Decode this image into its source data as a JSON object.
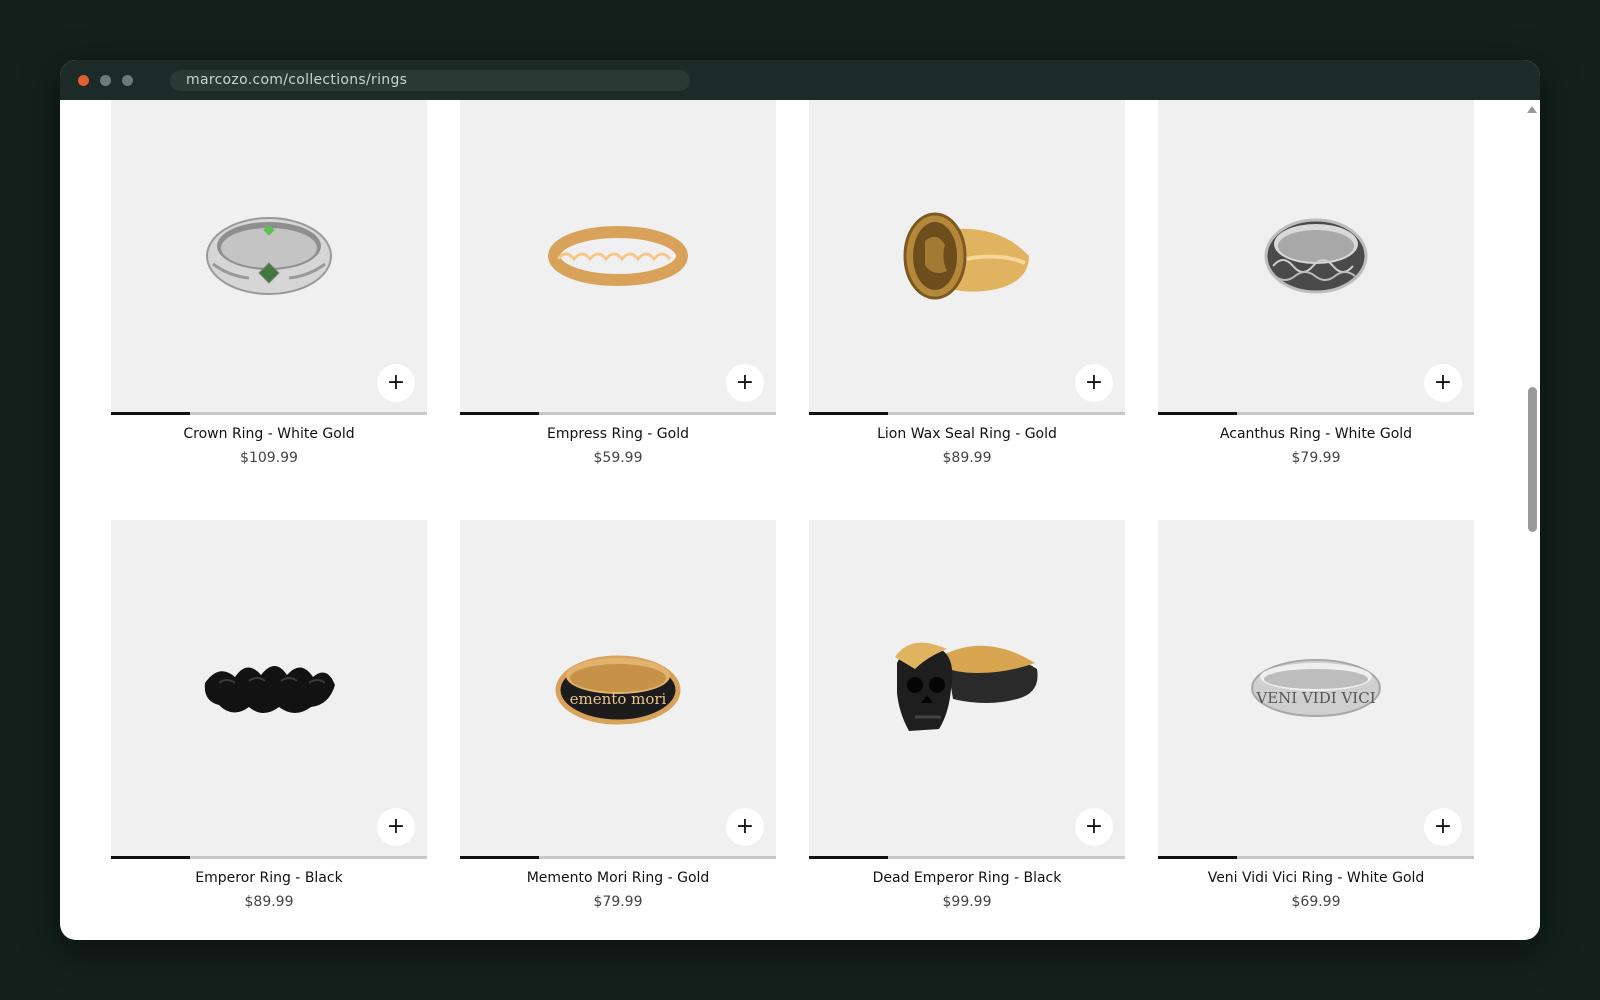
{
  "browser": {
    "url": "marcozo.com/collections/rings"
  },
  "products": [
    {
      "name": "Crown Ring - White Gold",
      "price": "$109.99",
      "add_icon": "plus-icon",
      "add_label": "+",
      "image_progress": 0.25
    },
    {
      "name": "Empress Ring - Gold",
      "price": "$59.99",
      "add_icon": "plus-icon",
      "add_label": "+",
      "image_progress": 0.25
    },
    {
      "name": "Lion Wax Seal Ring - Gold",
      "price": "$89.99",
      "add_icon": "plus-icon",
      "add_label": "+",
      "image_progress": 0.25
    },
    {
      "name": "Acanthus Ring - White Gold",
      "price": "$79.99",
      "add_icon": "plus-icon",
      "add_label": "+",
      "image_progress": 0.25
    },
    {
      "name": "Emperor Ring - Black",
      "price": "$89.99",
      "add_icon": "plus-icon",
      "add_label": "+",
      "image_progress": 0.25
    },
    {
      "name": "Memento Mori Ring - Gold",
      "price": "$79.99",
      "add_icon": "plus-icon",
      "add_label": "+",
      "image_progress": 0.25,
      "engraving": "emento mori"
    },
    {
      "name": "Dead Emperor Ring - Black",
      "price": "$99.99",
      "add_icon": "plus-icon",
      "add_label": "+",
      "image_progress": 0.25
    },
    {
      "name": "Veni Vidi Vici Ring - White Gold",
      "price": "$69.99",
      "add_icon": "plus-icon",
      "add_label": "+",
      "image_progress": 0.25,
      "engraving": "VENI VIDI VICI"
    }
  ],
  "colors": {
    "window_chrome": "#1c2b27",
    "page_background": "#13201c",
    "image_background": "#f0f0f0",
    "close_dot": "#e0612f"
  }
}
